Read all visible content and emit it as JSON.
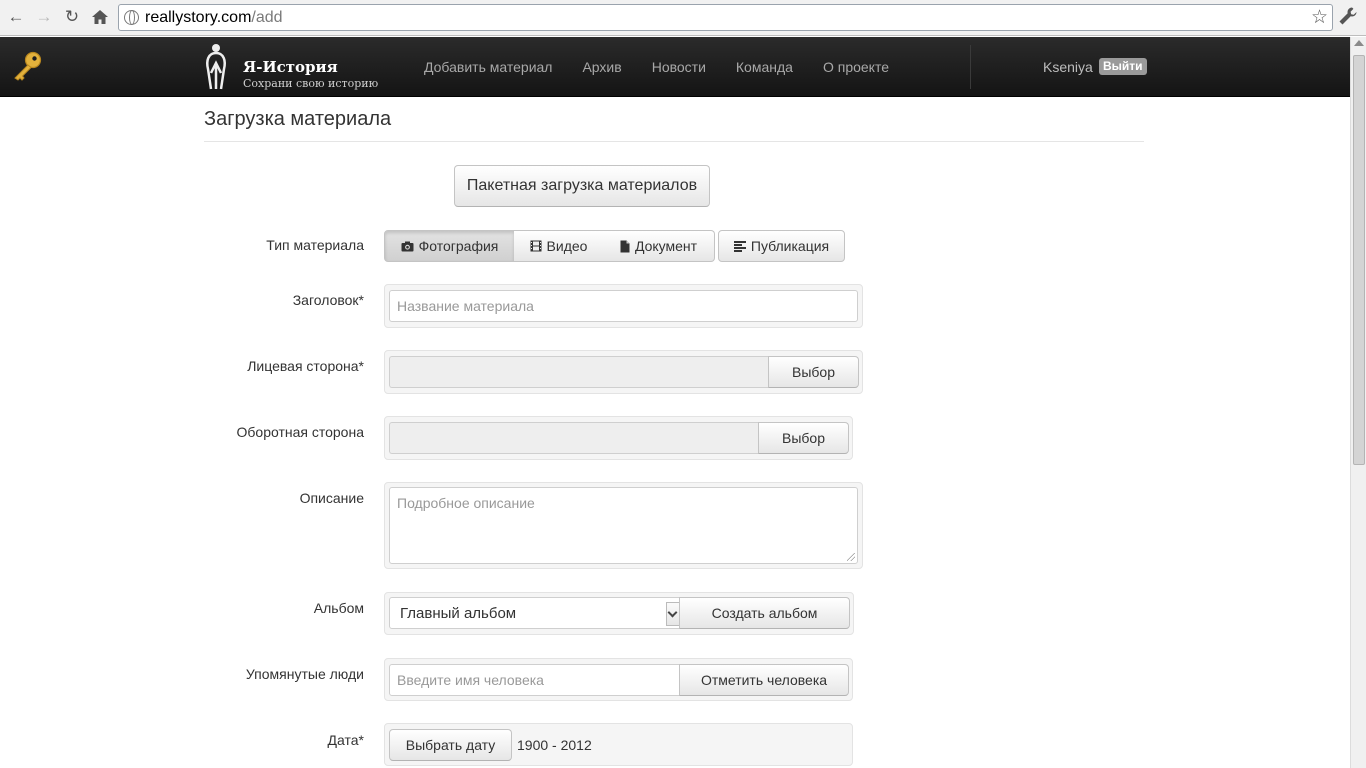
{
  "browser": {
    "url_host": "reallystory.com",
    "url_path": "/add"
  },
  "site": {
    "brand_title": "Я-История",
    "brand_subtitle": "Сохрани свою историю",
    "menu": [
      "Добавить материал",
      "Архив",
      "Новости",
      "Команда",
      "О проекте"
    ],
    "user_name": "Kseniya",
    "logout_label": "Выйти"
  },
  "page": {
    "title": "Загрузка материала",
    "batch_upload_label": "Пакетная загрузка материалов"
  },
  "form": {
    "type_label": "Тип материала",
    "types": [
      {
        "label": "Фотография",
        "icon": "camera-icon",
        "active": true
      },
      {
        "label": "Видео",
        "icon": "film-icon",
        "active": false
      },
      {
        "label": "Документ",
        "icon": "file-icon",
        "active": false
      },
      {
        "label": "Публикация",
        "icon": "align-left-icon",
        "active": false
      }
    ],
    "heading_label": "Заголовок*",
    "heading_placeholder": "Название материала",
    "front_label": "Лицевая сторона*",
    "back_label": "Оборотная сторона",
    "choose_label": "Выбор",
    "description_label": "Описание",
    "description_placeholder": "Подробное описание",
    "album_label": "Альбом",
    "album_selected": "Главный альбом",
    "create_album_label": "Создать альбом",
    "people_label": "Упомянутые люди",
    "people_placeholder": "Введите имя человека",
    "tag_person_label": "Отметить человека",
    "date_label": "Дата*",
    "choose_date_label": "Выбрать дату",
    "date_range": "1900 - 2012"
  }
}
